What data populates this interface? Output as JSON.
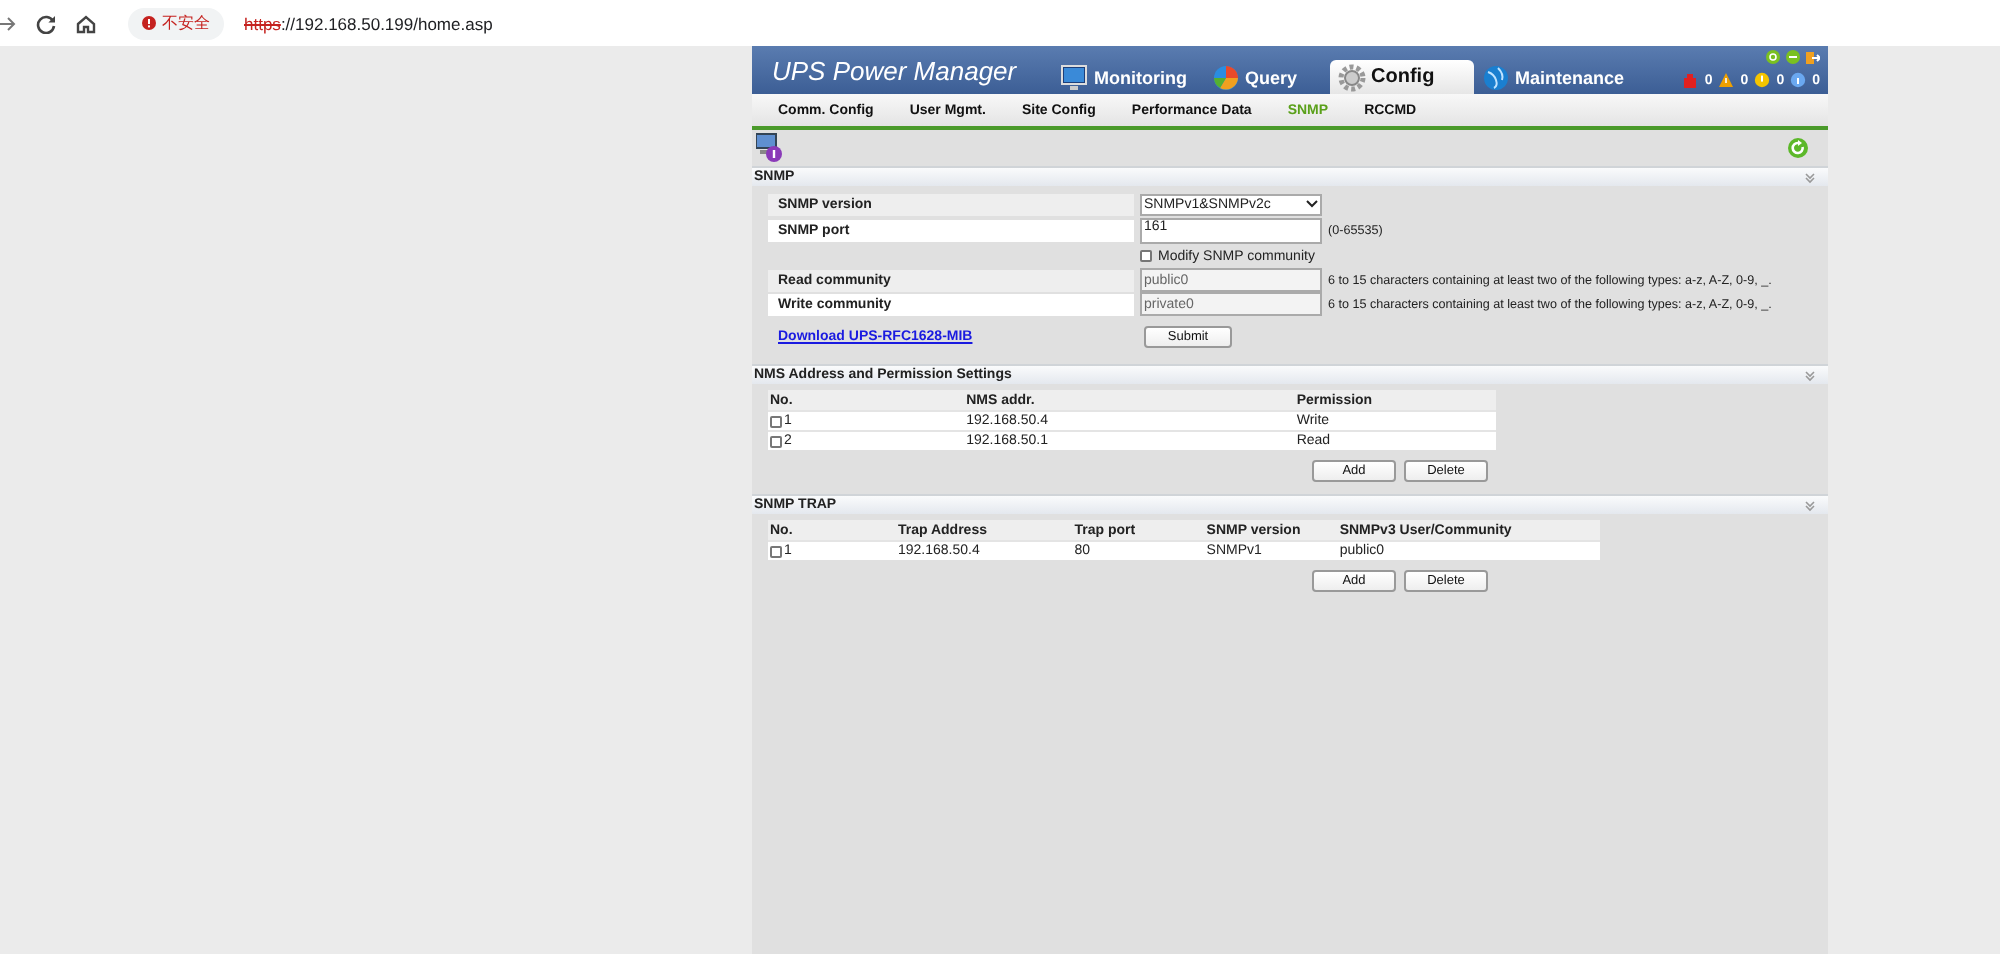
{
  "browser": {
    "security": "不安全",
    "url_scheme": "https",
    "url_rest": "://192.168.50.199/home.asp"
  },
  "app": {
    "title": "UPS Power Manager",
    "tabs": [
      {
        "label": "Monitoring",
        "selected": false,
        "kind": "monitor"
      },
      {
        "label": "Query",
        "selected": false,
        "kind": "pie"
      },
      {
        "label": "Config",
        "selected": true,
        "kind": "gear"
      },
      {
        "label": "Maintenance",
        "selected": false,
        "kind": "globe"
      }
    ],
    "alarms": [
      {
        "kind": "critical",
        "count": "0"
      },
      {
        "kind": "warning",
        "count": "0"
      },
      {
        "kind": "caution",
        "count": "0"
      },
      {
        "kind": "info",
        "count": "0"
      }
    ]
  },
  "subtabs": [
    {
      "label": "Comm. Config",
      "selected": false
    },
    {
      "label": "User Mgmt.",
      "selected": false
    },
    {
      "label": "Site Config",
      "selected": false
    },
    {
      "label": "Performance Data",
      "selected": false
    },
    {
      "label": "SNMP",
      "selected": true
    },
    {
      "label": "RCCMD",
      "selected": false
    }
  ],
  "snmp": {
    "title": "SNMP",
    "version": {
      "label": "SNMP version",
      "value": "SNMPv1&SNMPv2c"
    },
    "port": {
      "label": "SNMP port",
      "value": "161",
      "hint": "(0-65535)"
    },
    "modify": {
      "label": "Modify SNMP community",
      "checked": false
    },
    "communities": [
      {
        "label": "Read community",
        "value": "public0",
        "disabled": true,
        "hint": "6 to 15 characters containing at least two of the following types: a-z, A-Z, 0-9, _."
      },
      {
        "label": "Write community",
        "value": "private0",
        "disabled": true,
        "hint": "6 to 15 characters containing at least two of the following types: a-z, A-Z, 0-9, _."
      }
    ],
    "mib_link": "Download UPS-RFC1628-MIB",
    "submit": "Submit"
  },
  "nms": {
    "title": "NMS Address and Permission Settings",
    "columns": [
      "No.",
      "NMS addr.",
      "Permission"
    ],
    "rows": [
      {
        "checked": false,
        "cells": [
          "1",
          "192.168.50.4",
          "Write"
        ]
      },
      {
        "checked": false,
        "cells": [
          "2",
          "192.168.50.1",
          "Read"
        ]
      }
    ],
    "buttons": [
      "Add",
      "Delete"
    ]
  },
  "trap": {
    "title": "SNMP TRAP",
    "columns": [
      "No.",
      "Trap Address",
      "Trap port",
      "SNMP version",
      "SNMPv3 User/Community"
    ],
    "rows": [
      {
        "checked": false,
        "cells": [
          "1",
          "192.168.50.4",
          "80",
          "SNMPv1",
          "public0"
        ]
      }
    ],
    "buttons": [
      "Add",
      "Delete"
    ]
  }
}
